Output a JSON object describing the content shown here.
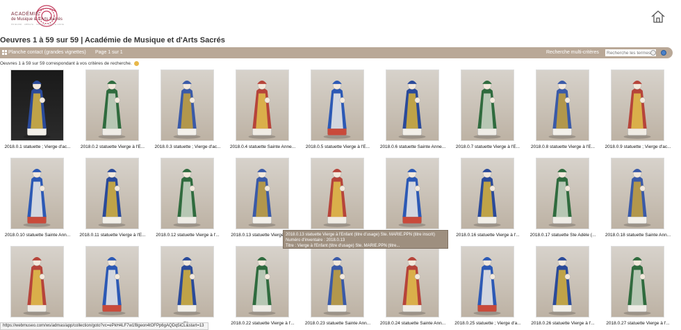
{
  "logo": {
    "line1": "ACADÉMIE",
    "line2": "de Musique & d'Arts Sacrés",
    "line3": "PRIEURÉ · ABBAYE · VIERGE · SAINTE-ANNE",
    "accent_color": "#c23a5c"
  },
  "header": {
    "title": "Oeuvres 1 à 59 sur 59 | Académie de Musique et d'Arts Sacrés",
    "home_icon": "home-icon"
  },
  "toolbar": {
    "view_label": "Planche contact (grandes vignettes)",
    "page_info": "Page 1 sur 1",
    "multi_search": "Recherche multi-critères",
    "search_placeholder": "Recherche les termes",
    "bar_color": "#b9a897"
  },
  "results": {
    "summary": "Oeuvres 1 à 59 sur 59 correspondant à vos critères de recherche."
  },
  "items": [
    {
      "caption": "2018.0.1 statuette ; Vierge d'ac...",
      "tone": "dark"
    },
    {
      "caption": "2018.0.2 statuette Vierge à l'E...",
      "tone": "light"
    },
    {
      "caption": "2018.0.3 statuette ; Vierge d'ac...",
      "tone": "light"
    },
    {
      "caption": "2018.0.4 statuette Sainte Anne...",
      "tone": "light"
    },
    {
      "caption": "2018.0.5 statuette Vierge à l'E...",
      "tone": "light"
    },
    {
      "caption": "2018.0.6 statuette Sainte Anne...",
      "tone": "light"
    },
    {
      "caption": "2018.0.7 statuette Vierge à l'E...",
      "tone": "light"
    },
    {
      "caption": "2018.0.8 statuette Vierge à l'E...",
      "tone": "light"
    },
    {
      "caption": "2018.0.9 statuette ; Vierge d'ac...",
      "tone": "light"
    },
    {
      "caption": "2018.0.10 statuette Sainte Ann...",
      "tone": "light"
    },
    {
      "caption": "2018.0.11 statuette Vierge à l'E...",
      "tone": "light"
    },
    {
      "caption": "2018.0.12 statuette Vierge à l'...",
      "tone": "light"
    },
    {
      "caption": "2018.0.13 statuette Vierge à l'...",
      "tone": "light"
    },
    {
      "caption": "",
      "tone": "light"
    },
    {
      "caption": "",
      "tone": "light"
    },
    {
      "caption": "2018.0.16 statuette Vierge à l'...",
      "tone": "light"
    },
    {
      "caption": "2018.0.17 statuette Ste Adèle (...",
      "tone": "light"
    },
    {
      "caption": "2018.0.18 statuette Sainte Ann...",
      "tone": "light"
    },
    {
      "caption": "",
      "tone": "light"
    },
    {
      "caption": "",
      "tone": "light"
    },
    {
      "caption": "d'a...",
      "tone": "light"
    },
    {
      "caption": "2018.0.22 statuette Vierge à l'...",
      "tone": "light"
    },
    {
      "caption": "2018.0.23 statuette Sainte Ann...",
      "tone": "light"
    },
    {
      "caption": "2018.0.24 statuette Sainte Ann...",
      "tone": "light"
    },
    {
      "caption": "2018.0.25 statuette ; Vierge d'a...",
      "tone": "light"
    },
    {
      "caption": "2018.0.26 statuette Vierge à l'...",
      "tone": "light"
    },
    {
      "caption": "2018.0.27 statuette Vierge à l'...",
      "tone": "light"
    }
  ],
  "tooltip": {
    "line1": "2018.0.13 statuette Vierge à l'Enfant (titre d'usage) Ste. MARIE.PPN (titre inscrit)",
    "line2": "Numéro d'inventaire : 2018.0.13",
    "line3": "Titre : Vierge à l'Enfant (titre d'usage) Ste. MARIE.PPN (titre..."
  },
  "statusbar": {
    "url": "https://webmuseo.com/ws/admas/app/collection/goto?vc=ePkH4LF7w1f8geon4tOFPp6gAQDq5iCL&start=13"
  }
}
